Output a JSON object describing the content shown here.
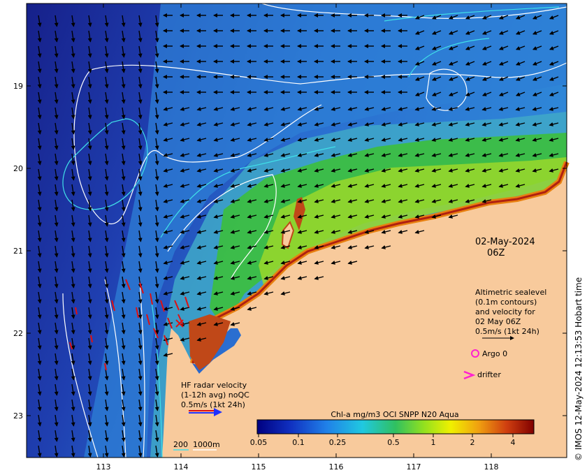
{
  "map": {
    "lat_ticks": [
      "19",
      "20",
      "21",
      "22",
      "23"
    ],
    "lon_ticks": [
      "113",
      "114",
      "115",
      "116",
      "117",
      "118"
    ],
    "date_line1": "02-May-2024",
    "date_line2": "06Z",
    "altimetry_note": [
      "Altimetric sealevel",
      "(0.1m contours)",
      "and velocity for",
      "02 May 06Z",
      "0.5m/s (1kt 24h)"
    ],
    "argo_label": "Argo 0",
    "drifter_label": "drifter",
    "hf_radar_note": [
      "HF radar velocity",
      "(1-12h avg) noQC",
      "0.5m/s (1kt 24h)"
    ],
    "depth_label_200": "200",
    "depth_label_1000": "1000m",
    "colorbar_title": "Chl-a mg/m3 OCI SNPP N20 Aqua",
    "colorbar_ticks": [
      "0.05",
      "0.1",
      "0.25",
      "0.5",
      "1",
      "2",
      "4"
    ],
    "credit": "© IMOS 12-May-2024 12:13:53 Hobart time",
    "colors": {
      "land": "#f8ca9c",
      "ocean_deep": "#1a2ea0",
      "ocean_mid": "#2a6ed0",
      "shelf": "#3fa8c8",
      "green": "#3cbf3c",
      "yellow": "#f0e000",
      "orange": "#e88010",
      "red": "#b02010",
      "contour_white": "#ffffff",
      "contour_cyan": "#40e0e8",
      "argo": "#ff20d0",
      "hf_radar": "#e01010"
    }
  }
}
